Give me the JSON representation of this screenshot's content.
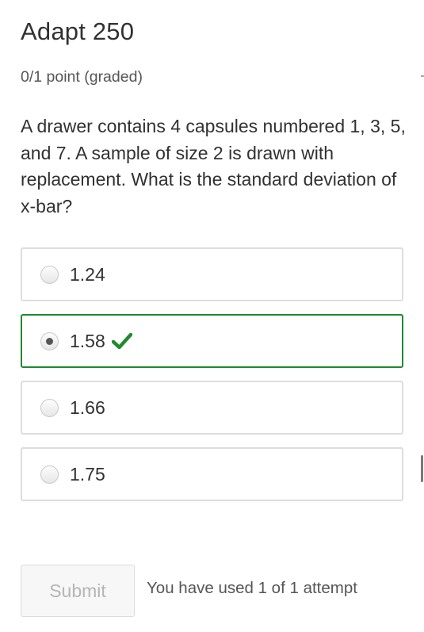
{
  "problem": {
    "title": "Adapt 250",
    "points": "0/1 point (graded)",
    "question": "A drawer contains 4 capsules numbered 1, 3, 5, and 7. A sample of size 2 is drawn with replacement. What is the standard deviation of x-bar?"
  },
  "options": [
    {
      "label": "1.24",
      "selected": false,
      "correct": false
    },
    {
      "label": "1.58",
      "selected": true,
      "correct": true
    },
    {
      "label": "1.66",
      "selected": false,
      "correct": false
    },
    {
      "label": "1.75",
      "selected": false,
      "correct": false
    }
  ],
  "footer": {
    "submit_label": "Submit",
    "attempts_text": "You have used 1 of 1 attempt"
  },
  "colors": {
    "correct": "#1f8a2e",
    "border": "#dddddd",
    "text": "#313131"
  },
  "icons": {
    "correct_indicator": "check-icon"
  }
}
